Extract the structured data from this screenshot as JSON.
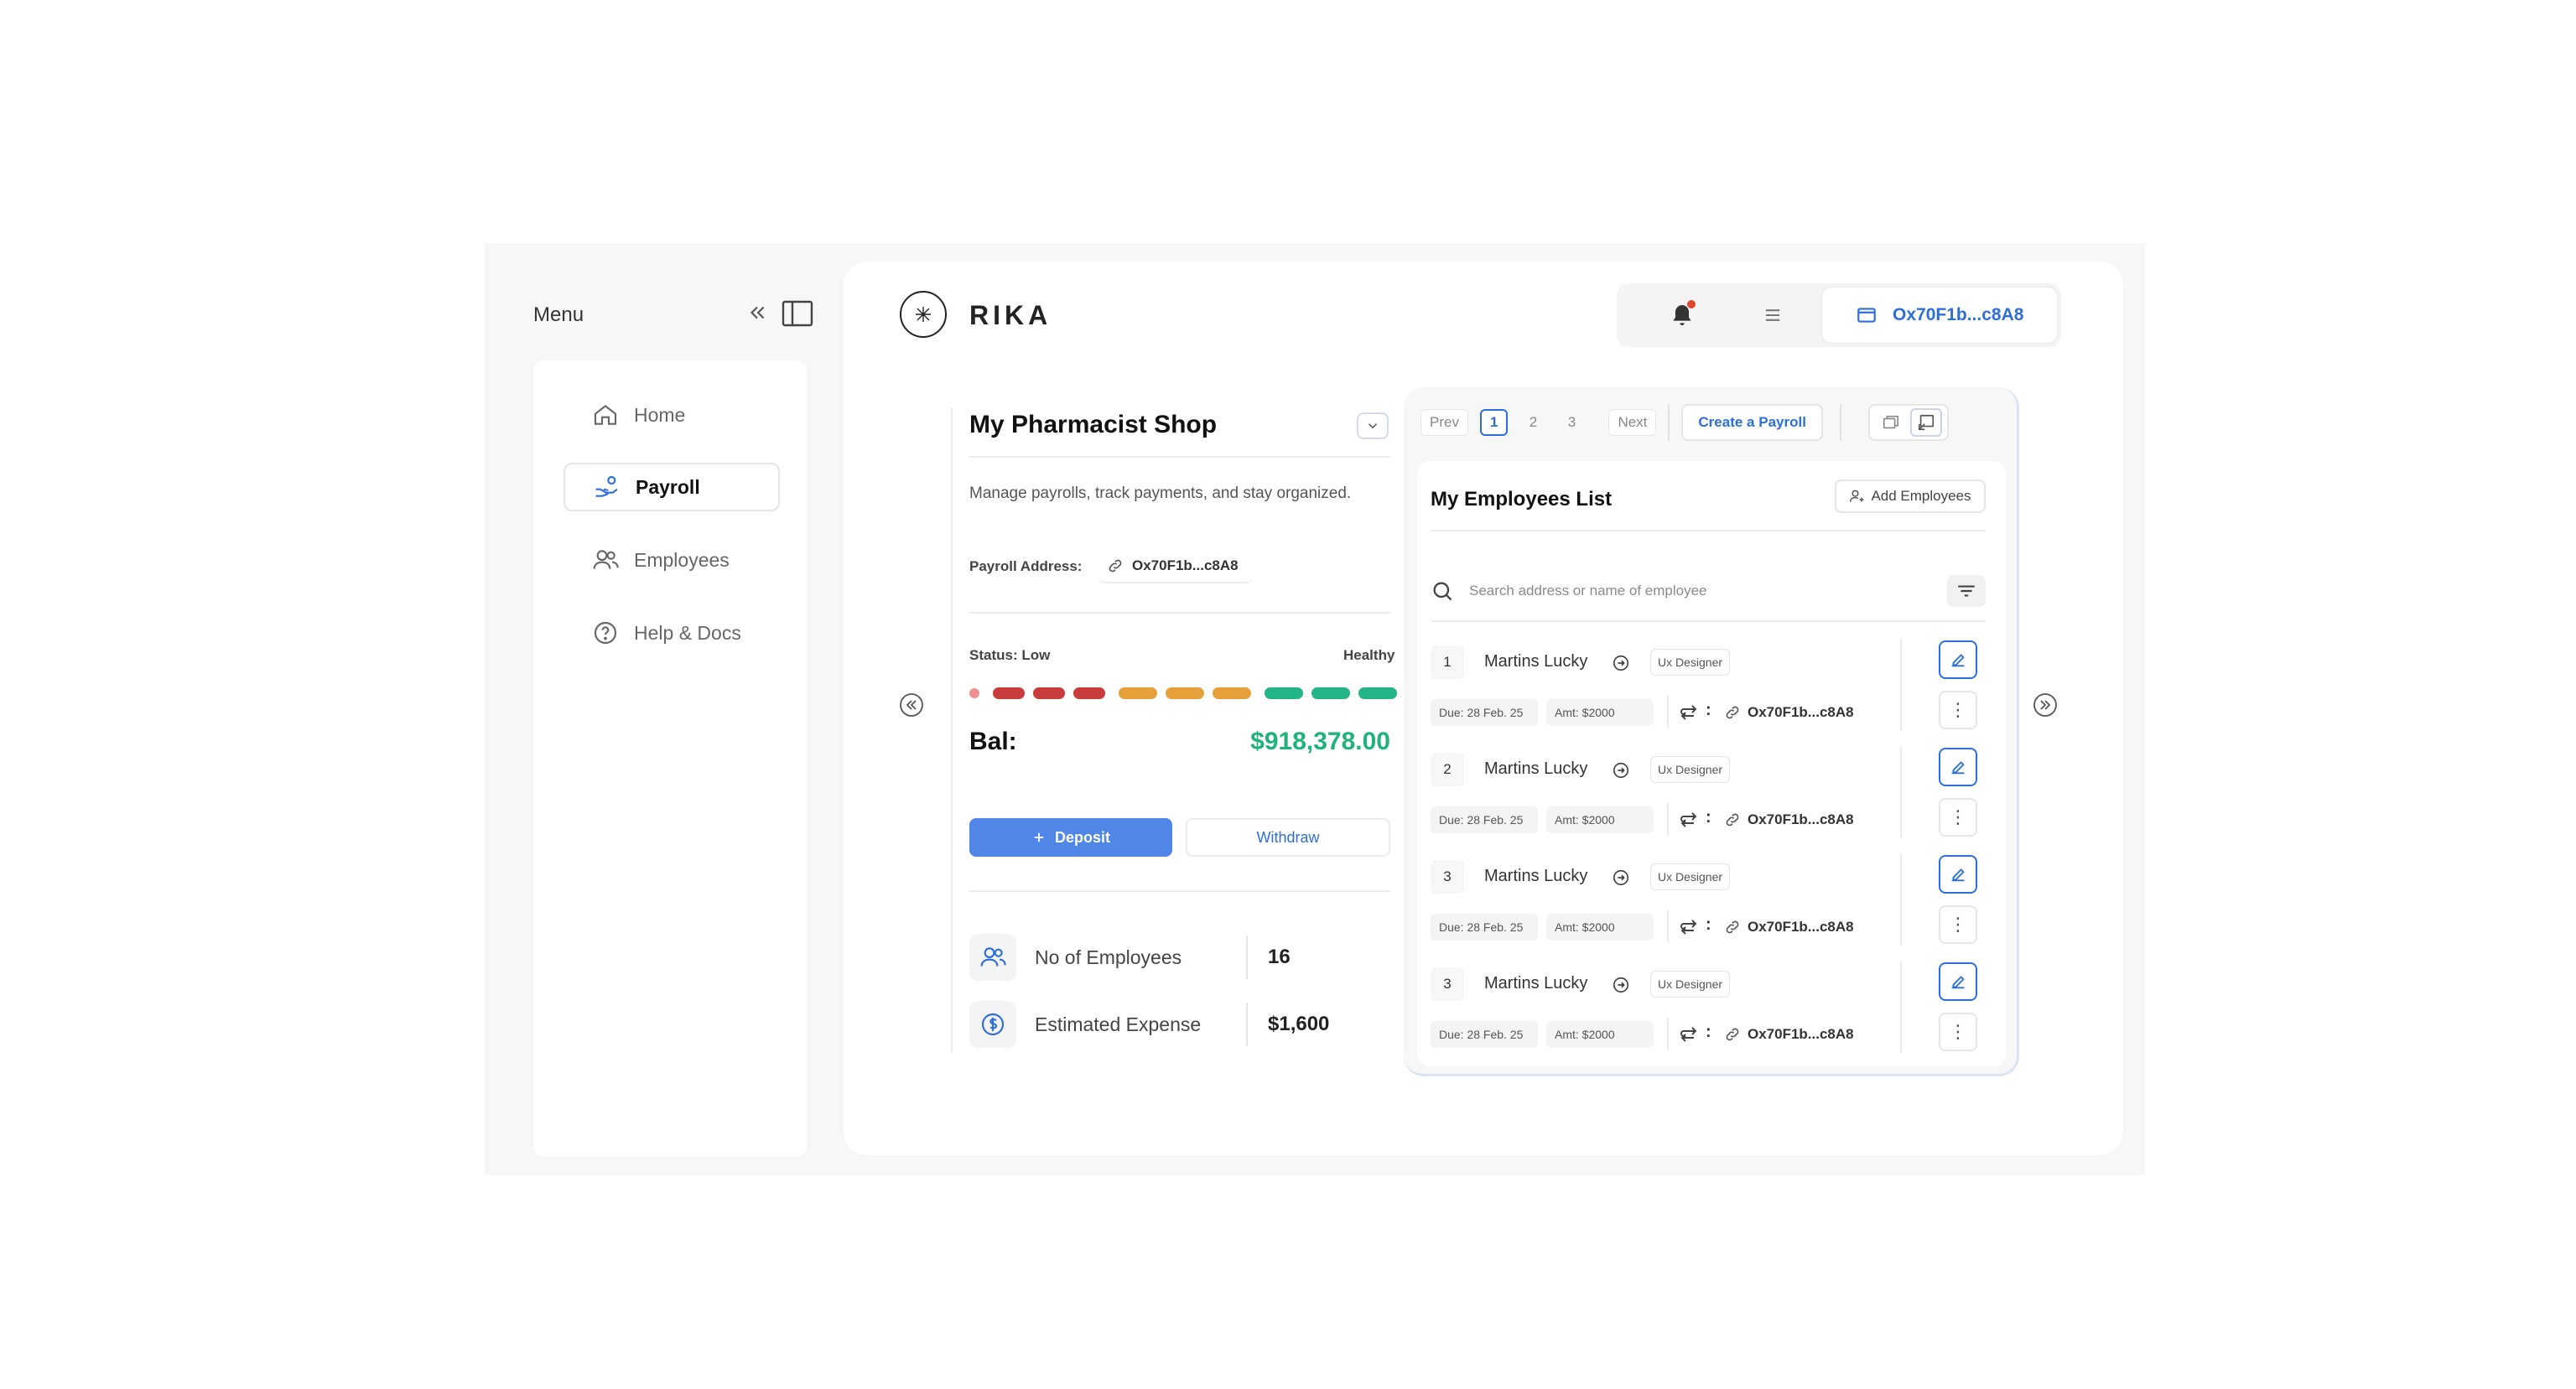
{
  "sidebar": {
    "title": "Menu",
    "items": [
      {
        "label": "Home",
        "icon": "home-icon",
        "active": false
      },
      {
        "label": "Payroll",
        "icon": "payroll-hand-icon",
        "active": true
      },
      {
        "label": "Employees",
        "icon": "users-icon",
        "active": false
      },
      {
        "label": "Help & Docs",
        "icon": "help-circle-icon",
        "active": false
      }
    ]
  },
  "header": {
    "brand": "RIKA",
    "wallet_address": "Ox70F1b...c8A8"
  },
  "shop": {
    "title": "My Pharmacist Shop",
    "description": "Manage payrolls, track payments, and stay organized.",
    "address_label": "Payroll Address:",
    "address_value": "Ox70F1b...c8A8",
    "status_left": "Status: Low",
    "status_right": "Healthy",
    "balance_label": "Bal:",
    "balance_value": "$918,378.00",
    "deposit_label": "Deposit",
    "withdraw_label": "Withdraw",
    "status_colors": [
      "#c83c3c",
      "#e6a03a",
      "#22b487"
    ],
    "stats": [
      {
        "label": "No of Employees",
        "value": "16",
        "icon": "users-icon"
      },
      {
        "label": "Estimated Expense",
        "value": "$1,600",
        "icon": "dollar-circle-icon"
      }
    ]
  },
  "pager": {
    "prev": "Prev",
    "pages": [
      "1",
      "2",
      "3"
    ],
    "current": "1",
    "next": "Next",
    "create_label": "Create a Payroll"
  },
  "employees": {
    "title": "My Employees List",
    "add_label": "Add Employees",
    "search_placeholder": "Search address or name of employee",
    "rows": [
      {
        "num": "1",
        "name": "Martins Lucky",
        "role": "Ux Designer",
        "due": "Due: 28 Feb. 25",
        "amt": "Amt: $2000",
        "address": "Ox70F1b...c8A8"
      },
      {
        "num": "2",
        "name": "Martins Lucky",
        "role": "Ux Designer",
        "due": "Due: 28 Feb. 25",
        "amt": "Amt: $2000",
        "address": "Ox70F1b...c8A8"
      },
      {
        "num": "3",
        "name": "Martins Lucky",
        "role": "Ux Designer",
        "due": "Due: 28 Feb. 25",
        "amt": "Amt: $2000",
        "address": "Ox70F1b...c8A8"
      },
      {
        "num": "3",
        "name": "Martins Lucky",
        "role": "Ux Designer",
        "due": "Due: 28 Feb. 25",
        "amt": "Amt: $2000",
        "address": "Ox70F1b...c8A8"
      }
    ]
  },
  "colors": {
    "accent": "#2d6ed9",
    "deposit": "#4f86e7",
    "balance": "#20b27a"
  }
}
